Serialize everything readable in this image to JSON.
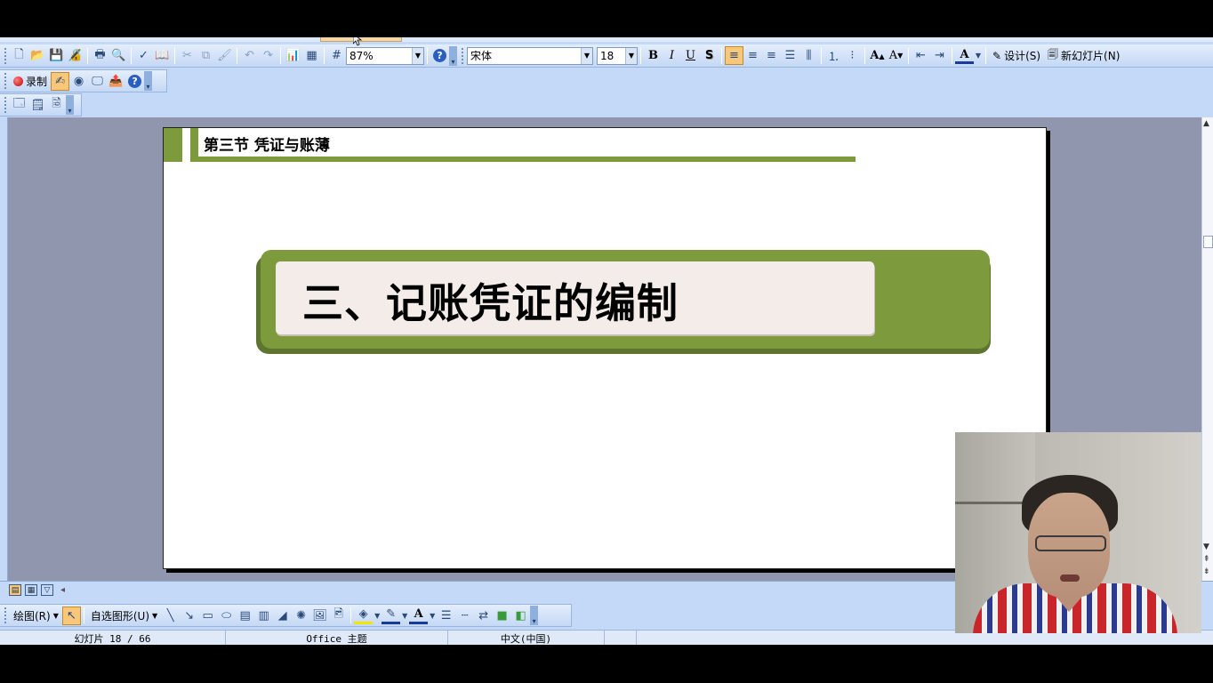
{
  "toolbar_standard": {
    "zoom": "87%",
    "font_name": "宋体",
    "font_size": "18",
    "bold": "B",
    "italic": "I",
    "underline": "U",
    "shadow": "S",
    "grow_font": "A",
    "shrink_font": "A",
    "font_color": "A",
    "design_label": "设计(S)",
    "new_slide_label": "新幻灯片(N)"
  },
  "toolbar_record": {
    "record_label": "录制"
  },
  "slide": {
    "header_title": "第三节 凭证与账薄",
    "banner_title": "三、记账凭证的编制"
  },
  "drawing_toolbar": {
    "draw_label": "绘图(R)",
    "autoshapes_label": "自选图形(U)"
  },
  "status_bar": {
    "slide_indicator": "幻灯片 18 / 66",
    "theme": "Office 主题",
    "language": "中文(中国)"
  },
  "colors": {
    "accent_green": "#7d9a3d",
    "banner_inner": "#f3ece8",
    "toolbar_blue": "#c3d9f7"
  }
}
